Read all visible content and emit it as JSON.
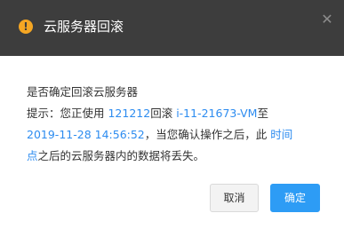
{
  "dialog": {
    "title": "云服务器回滚",
    "warning_icon_glyph": "!",
    "close_glyph": "✕",
    "icons": {
      "warning": "warning-circle-icon",
      "close": "close-icon"
    },
    "message": {
      "line1": "是否确定回滚云服务器",
      "prompt_prefix": "提示：您正使用 ",
      "snapshot_name": "121212",
      "rollback_word": "回滚 ",
      "instance_id": "i-11-21673-VM",
      "to_word": "至",
      "snapshot_time": "2019-11-28 14:56:52",
      "after_time_text": "，当您确认操作之后，此 ",
      "time_point_part1": "时间",
      "time_point_part2": "点",
      "tail_text": "之后的云服务器内的数据将丢失。"
    },
    "buttons": {
      "cancel_label": "取消",
      "confirm_label": "确定"
    },
    "colors": {
      "header_bg": "#3d3d3d",
      "warning": "#f5a623",
      "link_blue": "#2d8cf0",
      "confirm_bg": "#2d9cf5"
    }
  }
}
